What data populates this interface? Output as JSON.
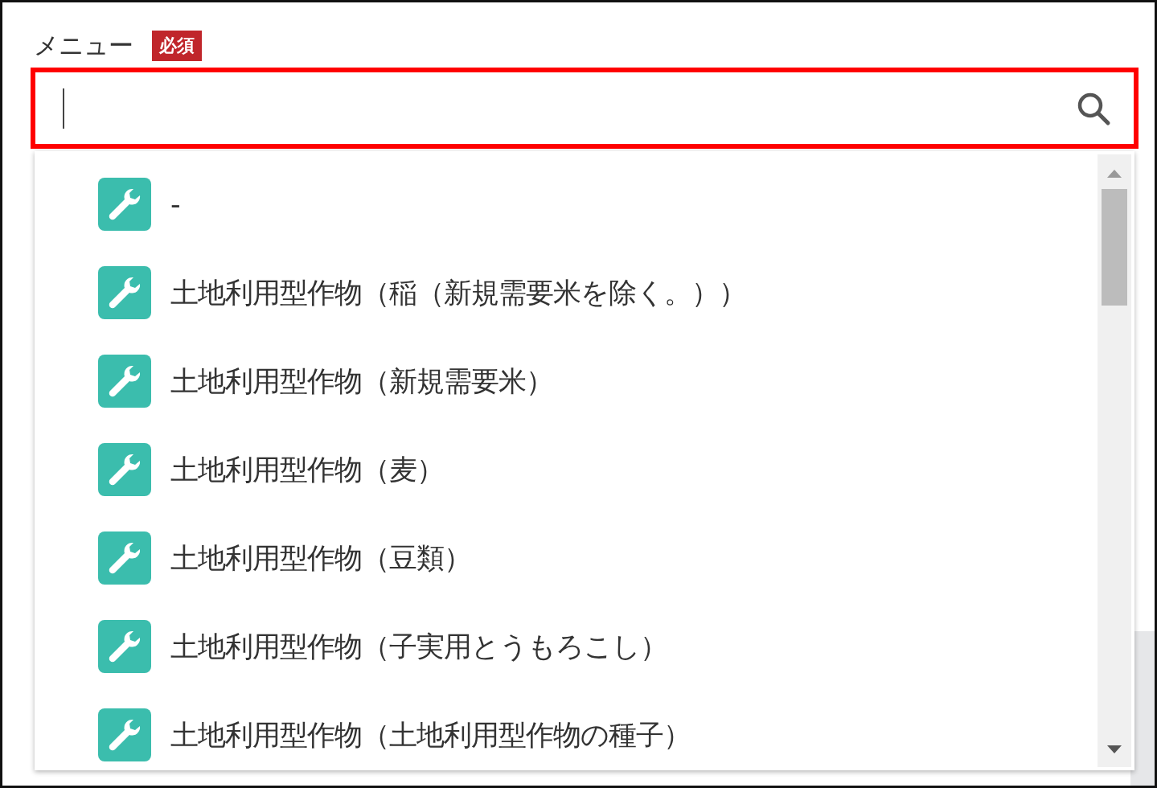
{
  "field": {
    "label": "メニュー",
    "required_badge": "必須",
    "highlighted": true
  },
  "options": [
    {
      "label": "-"
    },
    {
      "label": "土地利用型作物（稲（新規需要米を除く。））"
    },
    {
      "label": "土地利用型作物（新規需要米）"
    },
    {
      "label": "土地利用型作物（麦）"
    },
    {
      "label": "土地利用型作物（豆類）"
    },
    {
      "label": "土地利用型作物（子実用とうもろこし）"
    },
    {
      "label": "土地利用型作物（土地利用型作物の種子）"
    }
  ]
}
